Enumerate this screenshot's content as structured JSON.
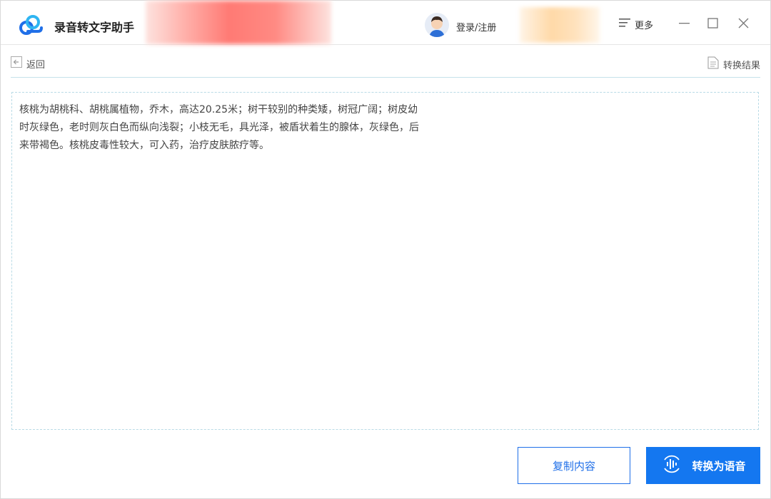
{
  "app": {
    "title": "录音转文字助手"
  },
  "header": {
    "login_label": "登录/注册",
    "more_label": "更多"
  },
  "toolbar": {
    "back_label": "返回",
    "result_label": "转换结果"
  },
  "editor": {
    "text": "核桃为胡桃科、胡桃属植物，乔木，高达20.25米；树干较别的种类矮，树冠广阔；树皮幼时灰绿色，老时则灰白色而纵向浅裂；小枝无毛，具光泽，被盾状着生的腺体，灰绿色，后来带褐色。核桃皮毒性较大，可入药，治疗皮肤脓疗等。"
  },
  "actions": {
    "copy_label": "复制内容",
    "convert_label": "转换为语音"
  },
  "colors": {
    "accent": "#1477f0",
    "border_dashed": "#b9dbe6"
  },
  "icons": {
    "logo": "app-logo-icon",
    "avatar": "user-avatar-icon",
    "more": "menu-icon",
    "back": "back-arrow-icon",
    "result": "document-icon",
    "convert": "sound-wave-icon"
  }
}
